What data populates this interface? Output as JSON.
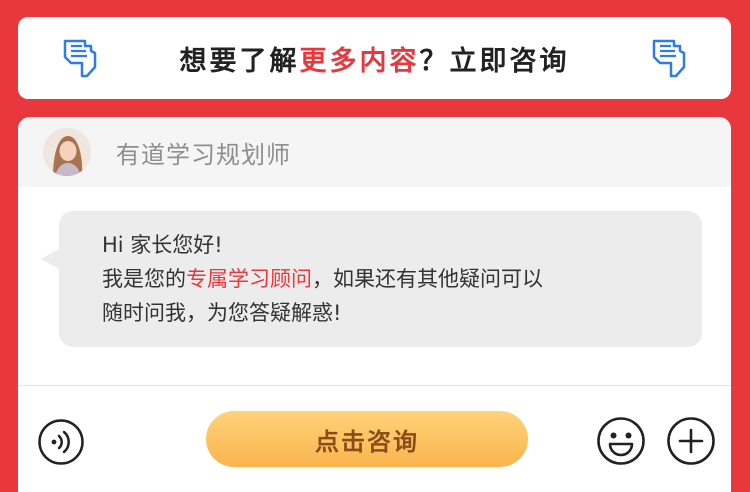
{
  "banner": {
    "text_before": "想要了解",
    "text_highlight": "更多内容",
    "text_after": "？立即咨询"
  },
  "chat": {
    "advisor_name": "有道学习规划师",
    "message": {
      "line1": "Hi 家长您好!",
      "line2_before": "我是您的",
      "line2_highlight": "专属学习顾问",
      "line2_after": "，如果还有其他疑问可以",
      "line3": "随时问我，为您答疑解惑!"
    }
  },
  "toolbar": {
    "consult_label": "点击咨询"
  },
  "icons": {
    "left_hand": "pointing-hand-icon",
    "right_hand": "pointing-hand-icon",
    "voice": "voice-icon",
    "emoji": "emoji-icon",
    "plus": "plus-icon"
  },
  "colors": {
    "brand_red": "#e8383d",
    "hand_blue": "#2f7de1",
    "cta_orange": "#f9b54e"
  }
}
